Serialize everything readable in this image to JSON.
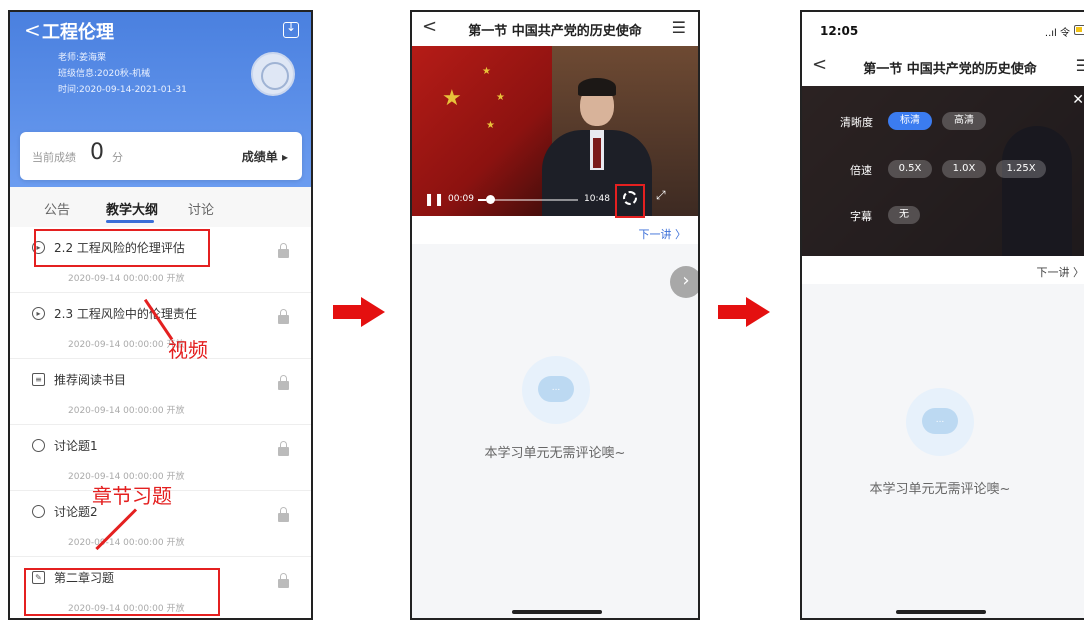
{
  "course": {
    "back_label": "<",
    "title": "工程伦理",
    "teacher": "老师:姜海栗",
    "class_info": "班级信息:2020秋-机械",
    "time": "时间:2020-09-14-2021-01-31",
    "score_label": "当前成绩",
    "score_value": "0",
    "score_unit": "分",
    "grades_label": "成绩单 ▸",
    "tabs": [
      "公告",
      "教学大纲",
      "讨论"
    ],
    "items": [
      {
        "title": "2.2 工程风险的伦理评估",
        "date": "2020-09-14 00:00:00 开放",
        "icon": "play-circle-icon"
      },
      {
        "title": "2.3 工程风险中的伦理责任",
        "date": "2020-09-14 00:00:00 开放",
        "icon": "play-circle-icon"
      },
      {
        "title": "推荐阅读书目",
        "date": "2020-09-14 00:00:00 开放",
        "icon": "document-icon"
      },
      {
        "title": "讨论题1",
        "date": "2020-09-14 00:00:00 开放",
        "icon": "chat-icon"
      },
      {
        "title": "讨论题2",
        "date": "2020-09-14 00:00:00 开放",
        "icon": "chat-icon"
      },
      {
        "title": "第二章习题",
        "date": "2020-09-14 00:00:00 开放",
        "icon": "exercise-icon"
      }
    ]
  },
  "annotations": {
    "video": "视频",
    "exercise": "章节习题"
  },
  "lesson": {
    "title": "第一节 中国共产党的历史使命",
    "back_label": "<",
    "menu_icon": "list-icon",
    "current_time": "00:09",
    "total_time": "10:48",
    "progress": 0.014,
    "next_label": "下一讲 〉",
    "empty_text": "本学习单元无需评论噢~",
    "bubble_text": "..."
  },
  "status_bar": {
    "time": "12:05",
    "signal": "..ıl 令"
  },
  "settings_overlay": {
    "clarity_label": "清晰度",
    "clarity_options": [
      "标清",
      "高清"
    ],
    "clarity_selected": "标清",
    "speed_label": "倍速",
    "speed_options": [
      "0.5X",
      "1.0X",
      "1.25X"
    ],
    "subtitle_label": "字幕",
    "subtitle_value": "无",
    "close_label": "✕"
  },
  "colors": {
    "header_blue": "#4a80df",
    "annotation_red": "#e42020",
    "selected_chip": "#3b7cf0"
  }
}
